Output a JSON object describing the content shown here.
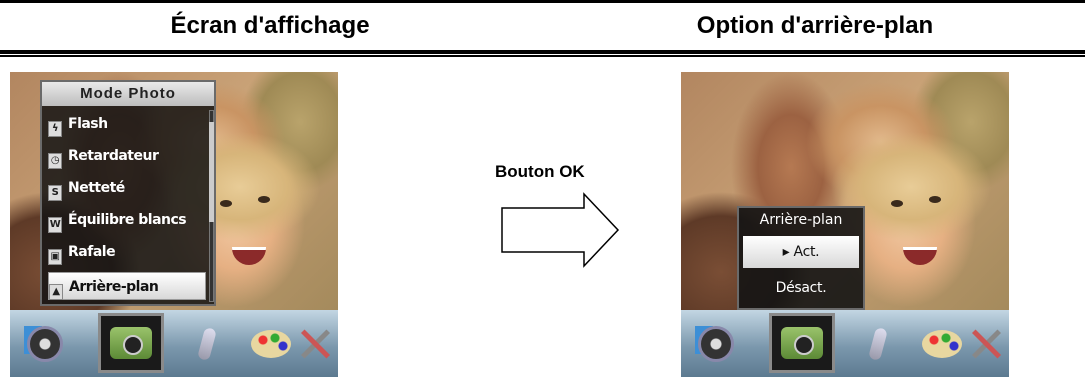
{
  "header": {
    "left_title": "Écran d'affichage",
    "right_title": "Option d'arrière-plan"
  },
  "arrow": {
    "label": "Bouton OK"
  },
  "left_screen": {
    "menu": {
      "title": "Mode Photo",
      "items": [
        {
          "label": "Flash",
          "icon": "flash-icon",
          "selected": false
        },
        {
          "label": "Retardateur",
          "icon": "timer-icon",
          "selected": false
        },
        {
          "label": "Netteté",
          "icon": "sharpness-icon",
          "selected": false
        },
        {
          "label": "Équilibre blancs",
          "icon": "white-balance-icon",
          "selected": false
        },
        {
          "label": "Rafale",
          "icon": "burst-icon",
          "selected": false
        },
        {
          "label": "Arrière-plan",
          "icon": "background-icon",
          "selected": true
        }
      ]
    }
  },
  "right_screen": {
    "popup": {
      "title": "Arrière-plan",
      "options": [
        {
          "label": "▸ Act.",
          "selected": true
        },
        {
          "label": "Désact.",
          "selected": false
        }
      ]
    }
  },
  "toolbar": {
    "items": [
      {
        "icon": "movie-mode-icon",
        "active": false
      },
      {
        "icon": "camera-mode-icon",
        "active": true
      },
      {
        "icon": "voice-record-icon",
        "active": false
      },
      {
        "icon": "effects-palette-icon",
        "active": false
      },
      {
        "icon": "settings-tools-icon",
        "active": false
      }
    ]
  }
}
